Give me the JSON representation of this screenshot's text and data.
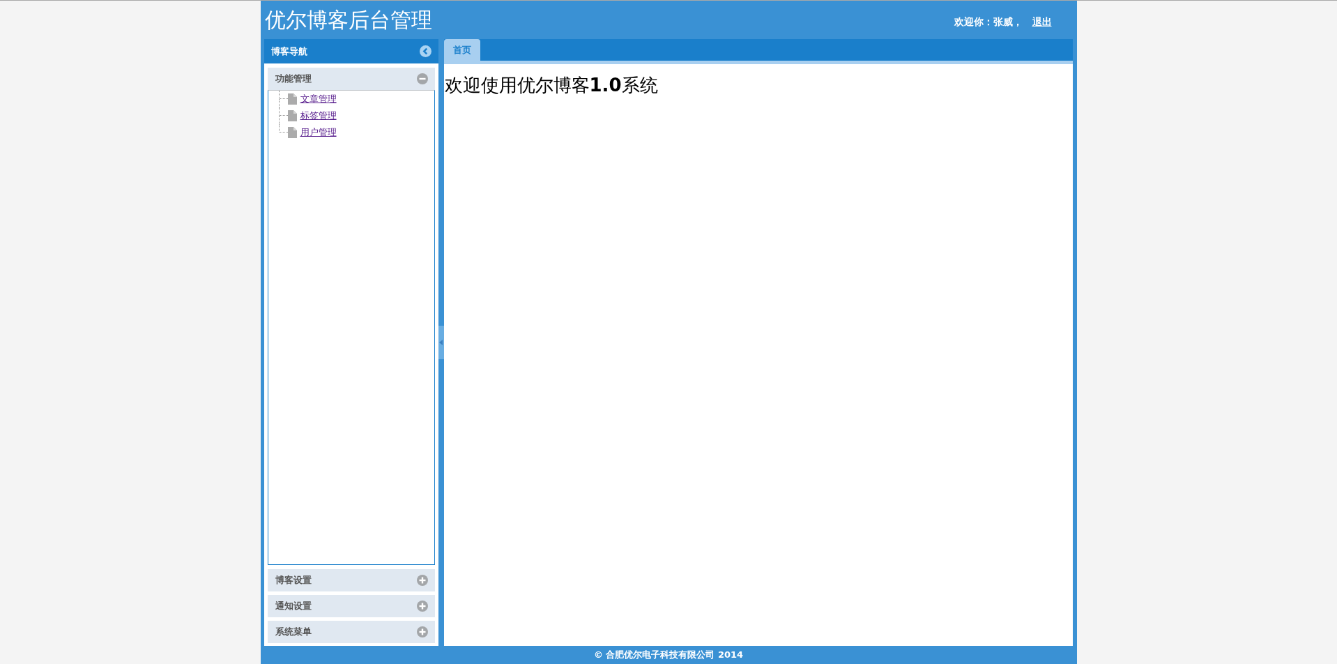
{
  "header": {
    "title": "优尔博客后台管理",
    "greeting": "欢迎你：张威，",
    "logout": "退出"
  },
  "sidebar": {
    "title": "博客导航",
    "menus": [
      {
        "title": "功能管理",
        "expanded": true,
        "items": [
          {
            "label": "文章管理",
            "visited": true
          },
          {
            "label": "标签管理",
            "visited": true
          },
          {
            "label": "用户管理",
            "visited": true
          }
        ]
      },
      {
        "title": "博客设置",
        "expanded": false
      },
      {
        "title": "通知设置",
        "expanded": false
      },
      {
        "title": "系统菜单",
        "expanded": false
      }
    ]
  },
  "tabs": [
    {
      "label": "首页",
      "selected": true
    }
  ],
  "content": {
    "heading": "欢迎使用优尔博客**1.0**系统"
  },
  "footer": {
    "text": "© 合肥优尔电子科技有限公司 2014"
  }
}
